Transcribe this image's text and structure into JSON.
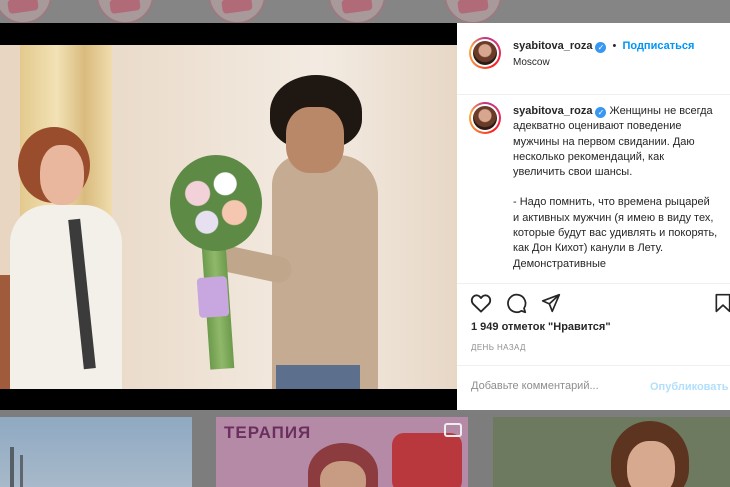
{
  "post": {
    "username": "syabitova_roza",
    "verified_mark": "✓",
    "separator": "•",
    "follow_label": "Подписаться",
    "location": "Moscow"
  },
  "caption": {
    "username": "syabitova_roza",
    "paragraph_1": "Женщины не всегда адекватно оценивают поведение мужчины на первом свидании. Даю несколько рекомендаций, как увеличить свои шансы.",
    "paragraph_2": "- Надо помнить, что времена рыцарей и активных мужчин (я имею в виду тех, которые будут вас удивлять и покорять, как Дон Кихот) канули в Лету. Демонстративные"
  },
  "stats": {
    "likes": "1 949 отметок \"Нравится\"",
    "time_ago": "ДЕНЬ НАЗАД"
  },
  "comment": {
    "placeholder": "Добавьте комментарий...",
    "publish_label": "Опубликовать"
  },
  "feed": {
    "thumb2_label": "ТЕРАПИЯ"
  },
  "icons": {
    "like": "heart-icon",
    "comment": "comment-icon",
    "share": "paper-plane-icon",
    "save": "bookmark-icon",
    "verified": "verified-badge-icon"
  },
  "colors": {
    "accent": "#0095f6",
    "verified": "#3897f0",
    "publish_disabled": "#b2dffc",
    "muted": "#8e8e8e"
  }
}
